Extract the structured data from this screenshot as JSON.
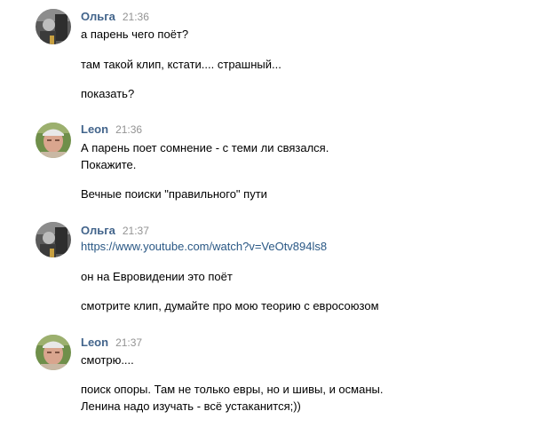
{
  "messages": [
    {
      "author": "Ольга",
      "time": "21:36",
      "avatar_icon": "olga-avatar",
      "lines": [
        "а парень чего поёт?",
        "там такой клип, кстати.... страшный...",
        "показать?"
      ]
    },
    {
      "author": "Leon",
      "time": "21:36",
      "avatar_icon": "leon-avatar",
      "lines": [
        "А парень поет сомнение - с теми ли связался.",
        "Покажите.",
        "Вечные поиски \"правильного\" пути"
      ]
    },
    {
      "author": "Ольга",
      "time": "21:37",
      "avatar_icon": "olga-avatar",
      "link": "https://www.youtube.com/watch?v=VeOtv894ls8",
      "lines": [
        "он на Евровидении это поёт",
        "смотрите клип, думайте про мою теорию с евросоюзом"
      ]
    },
    {
      "author": "Leon",
      "time": "21:37",
      "avatar_icon": "leon-avatar",
      "lines": [
        "смотрю....",
        "поиск опоры. Там не только евры, но и шивы, и османы.",
        "Ленина надо изучать - всё устаканится;))"
      ]
    }
  ],
  "colors": {
    "author": "#42648b",
    "time": "#939393",
    "link": "#2a5885",
    "text": "#000000",
    "background": "#ffffff"
  }
}
